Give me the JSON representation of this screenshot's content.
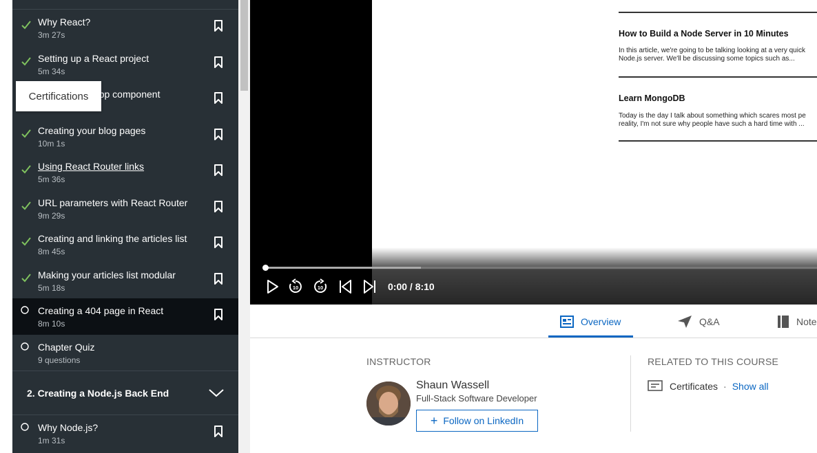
{
  "sidebar": {
    "items": [
      {
        "title": "Why React?",
        "duration": "3m 27s",
        "status": "done"
      },
      {
        "title": "Setting up a React project",
        "duration": "5m 34s",
        "status": "done"
      },
      {
        "title": "Creating the App component",
        "duration": "",
        "status": "done"
      },
      {
        "title": "Creating your blog pages",
        "duration": "10m 1s",
        "status": "done"
      },
      {
        "title": "Using React Router links",
        "duration": "5m 36s",
        "status": "done"
      },
      {
        "title": "URL parameters with React Router",
        "duration": "9m 29s",
        "status": "done"
      },
      {
        "title": "Creating and linking the articles list",
        "duration": "8m 45s",
        "status": "done"
      },
      {
        "title": "Making your articles list modular",
        "duration": "5m 18s",
        "status": "done"
      },
      {
        "title": "Creating a 404 page in React",
        "duration": "8m 10s",
        "status": "current"
      },
      {
        "title": "Chapter Quiz",
        "duration": "9 questions",
        "status": "todo"
      }
    ],
    "chapter": {
      "title": "2. Creating a Node.js Back End"
    },
    "chapter_items": [
      {
        "title": "Why Node.js?",
        "duration": "1m 31s",
        "status": "todo"
      }
    ]
  },
  "tooltip": {
    "text": "Certifications"
  },
  "video": {
    "slide": {
      "article1_title": "How to Build a Node Server in 10 Minutes",
      "article1_line1": "In this article, we're going to be talking looking at a very quick",
      "article1_line2": "Node.js server. We'll be discussing some topics such as...",
      "article2_title": "Learn MongoDB",
      "article2_line1": "Today is the day I talk about something which scares most pe",
      "article2_line2": "reality, I'm not sure why people have such a hard time with ..."
    },
    "time": "0:00 / 8:10",
    "progress": 0
  },
  "tabs": [
    {
      "label": "Overview",
      "icon": "overview-icon",
      "active": true
    },
    {
      "label": "Q&A",
      "icon": "send-icon",
      "active": false
    },
    {
      "label": "Notebook",
      "icon": "notebook-icon",
      "active": false
    }
  ],
  "instructor": {
    "section_label": "INSTRUCTOR",
    "name": "Shaun Wassell",
    "title": "Full-Stack Software Developer",
    "follow_label": "Follow on LinkedIn"
  },
  "related": {
    "section_label": "RELATED TO THIS COURSE",
    "certificates_label": "Certificates",
    "separator": "·",
    "show_all_label": "Show all"
  },
  "colors": {
    "accent": "#0a66c2",
    "sidebar_bg": "#283036",
    "check": "#7fc15e"
  }
}
